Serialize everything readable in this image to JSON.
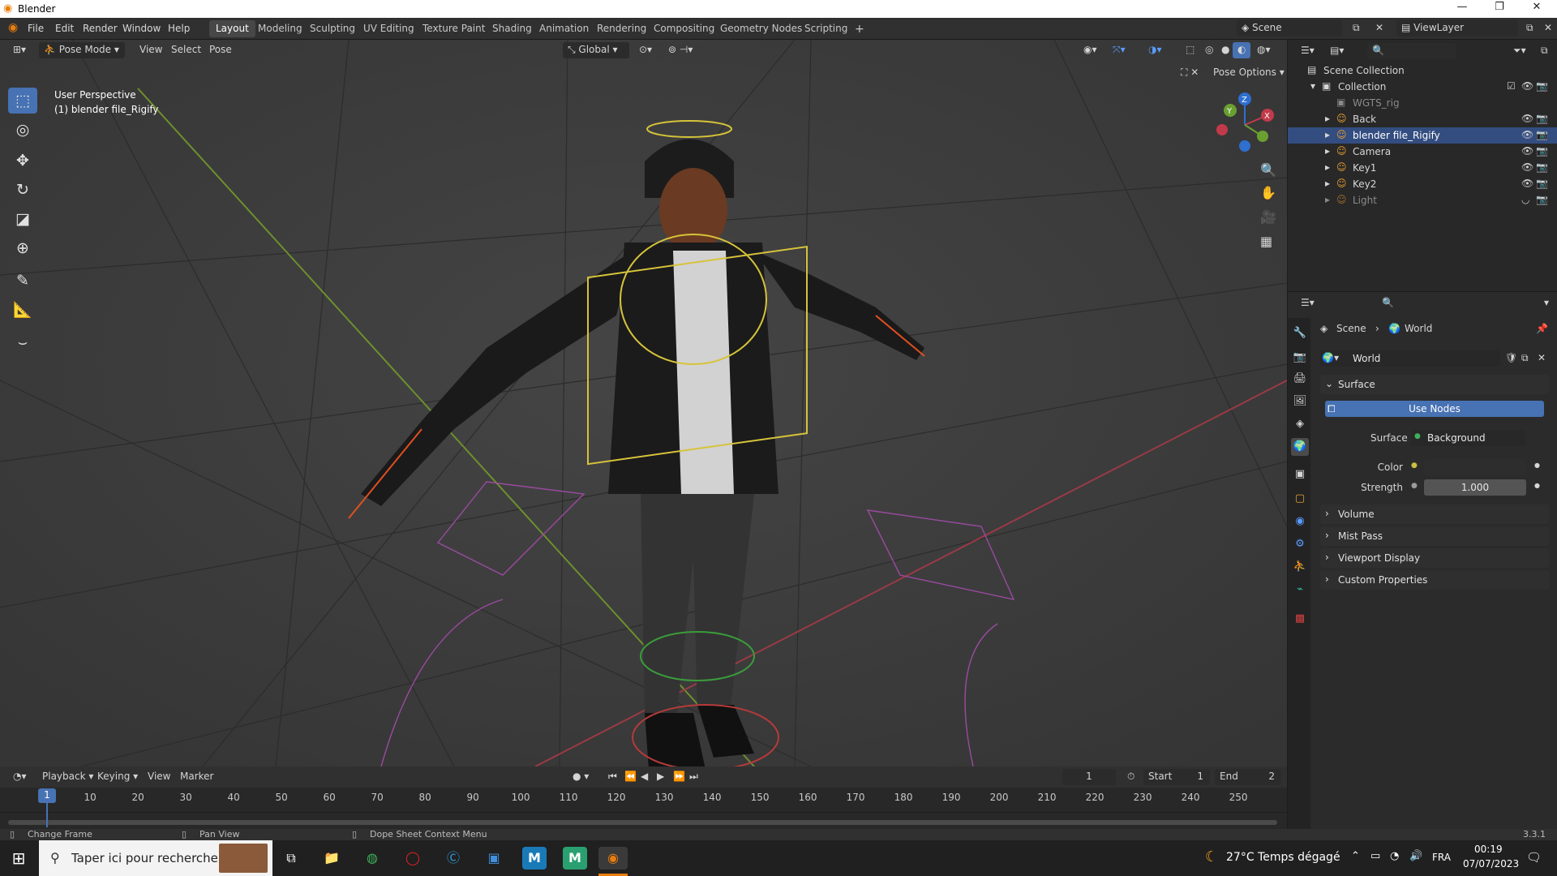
{
  "window": {
    "title": "Blender"
  },
  "menu": [
    "File",
    "Edit",
    "Render",
    "Window",
    "Help"
  ],
  "workspaces": [
    "Layout",
    "Modeling",
    "Sculpting",
    "UV Editing",
    "Texture Paint",
    "Shading",
    "Animation",
    "Rendering",
    "Compositing",
    "Geometry Nodes",
    "Scripting"
  ],
  "active_workspace": "Layout",
  "scene_name": "Scene",
  "view_layer": "ViewLayer",
  "viewport": {
    "mode": "Pose Mode",
    "menus": [
      "View",
      "Select",
      "Pose"
    ],
    "orientation": "Global",
    "pose_options": "Pose Options",
    "info_line1": "User Perspective",
    "info_line2": "(1) blender file_Rigify",
    "axis_x": "X",
    "axis_y": "Y",
    "axis_z": "Z"
  },
  "outliner": {
    "root": "Scene Collection",
    "collection": "Collection",
    "items": [
      "WGTS_rig",
      "Back",
      "blender file_Rigify",
      "Camera",
      "Key1",
      "Key2",
      "Light"
    ],
    "selected": "blender file_Rigify"
  },
  "properties": {
    "breadcrumb_scene": "Scene",
    "breadcrumb_world": "World",
    "world_name": "World",
    "panel_surface": "Surface",
    "use_nodes": "Use Nodes",
    "surface_label": "Surface",
    "surface_value": "Background",
    "color_label": "Color",
    "strength_label": "Strength",
    "strength_value": "1.000",
    "collapsed_panels": [
      "Volume",
      "Mist Pass",
      "Viewport Display",
      "Custom Properties"
    ]
  },
  "timeline": {
    "menus": [
      "Playback",
      "Keying",
      "View",
      "Marker"
    ],
    "current_frame": "1",
    "start_label": "Start",
    "start_value": "1",
    "end_label": "End",
    "end_value": "2",
    "ticks": [
      "1",
      "10",
      "20",
      "30",
      "40",
      "50",
      "60",
      "70",
      "80",
      "90",
      "100",
      "110",
      "120",
      "130",
      "140",
      "150",
      "160",
      "170",
      "180",
      "190",
      "200",
      "210",
      "220",
      "230",
      "240",
      "250"
    ]
  },
  "statusbar": {
    "hint1": "Change Frame",
    "hint2": "Pan View",
    "hint3": "Dope Sheet Context Menu",
    "version": "3.3.1"
  },
  "taskbar": {
    "search_placeholder": "Taper ici pour rechercher",
    "weather": "27°C  Temps dégagé",
    "language": "FRA",
    "time": "00:19",
    "date": "07/07/2023"
  },
  "colors": {
    "accent": "#4772b3",
    "selected_row": "#334d80",
    "viewport_bg": "#3d3d3d"
  }
}
